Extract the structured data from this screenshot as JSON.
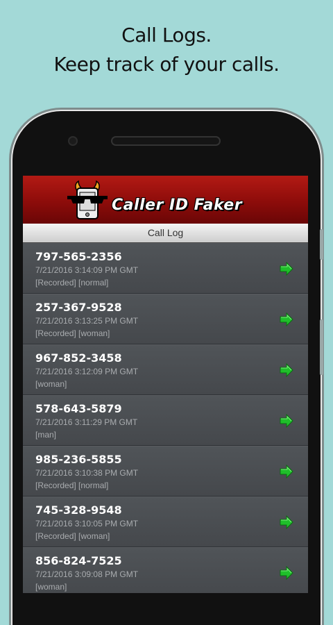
{
  "promo": {
    "line1": "Call Logs.",
    "line2": "Keep track of your calls."
  },
  "app": {
    "logo_text": "Caller ID Faker",
    "section_title": "Call Log"
  },
  "call_log": [
    {
      "number": "797-565-2356",
      "time": "7/21/2016 3:14:09 PM GMT",
      "tags": "[Recorded] [normal]"
    },
    {
      "number": "257-367-9528",
      "time": "7/21/2016 3:13:25 PM GMT",
      "tags": "[Recorded] [woman]"
    },
    {
      "number": "967-852-3458",
      "time": "7/21/2016 3:12:09 PM GMT",
      "tags": "[woman]"
    },
    {
      "number": "578-643-5879",
      "time": "7/21/2016 3:11:29 PM GMT",
      "tags": "[man]"
    },
    {
      "number": "985-236-5855",
      "time": "7/21/2016 3:10:38 PM GMT",
      "tags": "[Recorded] [normal]"
    },
    {
      "number": "745-328-9548",
      "time": "7/21/2016 3:10:05 PM GMT",
      "tags": "[Recorded] [woman]"
    },
    {
      "number": "856-824-7525",
      "time": "7/21/2016 3:09:08 PM GMT",
      "tags": "[woman]"
    }
  ],
  "colors": {
    "background": "#a3d9d7",
    "banner_red": "#b21a14",
    "arrow_green": "#1fbf2a",
    "row_bg": "#4a4d51"
  },
  "icons": {
    "row_action": "green-arrow-icon",
    "logo": "devil-phone-logo-icon"
  }
}
